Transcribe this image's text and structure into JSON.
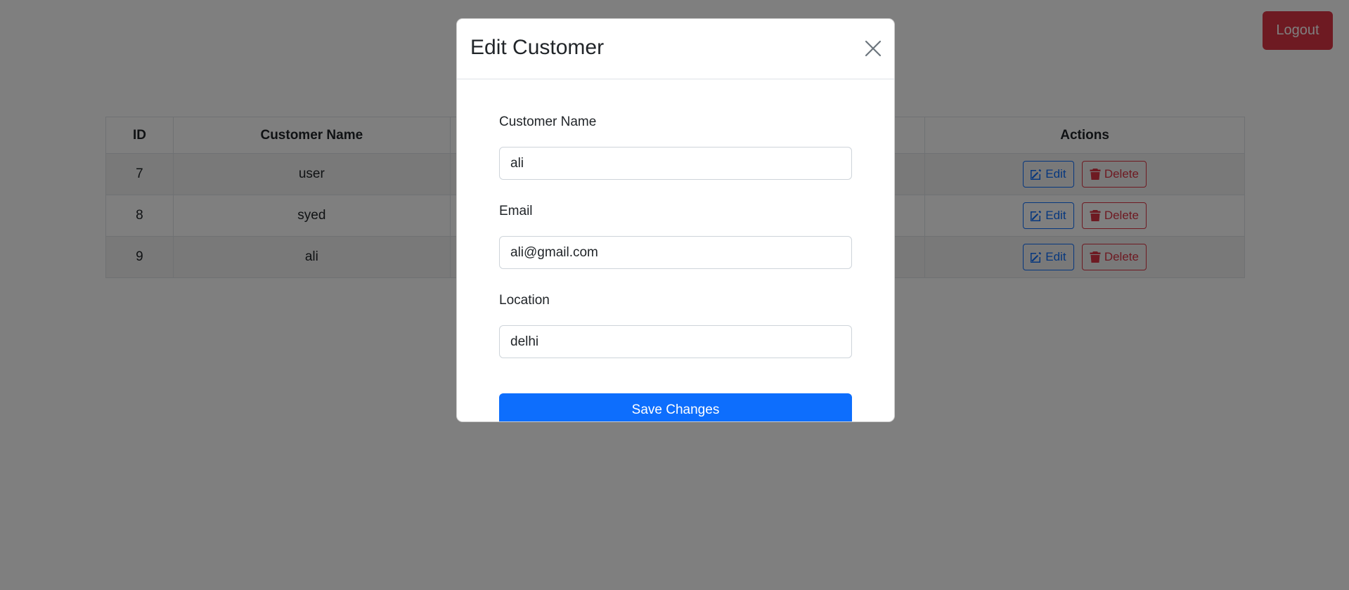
{
  "header": {
    "logout_label": "Logout"
  },
  "table": {
    "columns": [
      "ID",
      "Customer Name",
      "",
      "Actions"
    ],
    "rows": [
      {
        "id": "7",
        "name": "user",
        "edit": "Edit",
        "delete": "Delete"
      },
      {
        "id": "8",
        "name": "syed",
        "edit": "Edit",
        "delete": "Delete"
      },
      {
        "id": "9",
        "name": "ali",
        "edit": "Edit",
        "delete": "Delete"
      }
    ]
  },
  "modal": {
    "title": "Edit Customer",
    "fields": {
      "name_label": "Customer Name",
      "name_value": "ali",
      "email_label": "Email",
      "email_value": "ali@gmail.com",
      "location_label": "Location",
      "location_value": "delhi"
    },
    "save_label": "Save Changes",
    "close_icon": "close-icon"
  },
  "colors": {
    "primary": "#0d6efd",
    "danger": "#dc3545",
    "backdrop": "rgba(0,0,0,0.5)"
  }
}
